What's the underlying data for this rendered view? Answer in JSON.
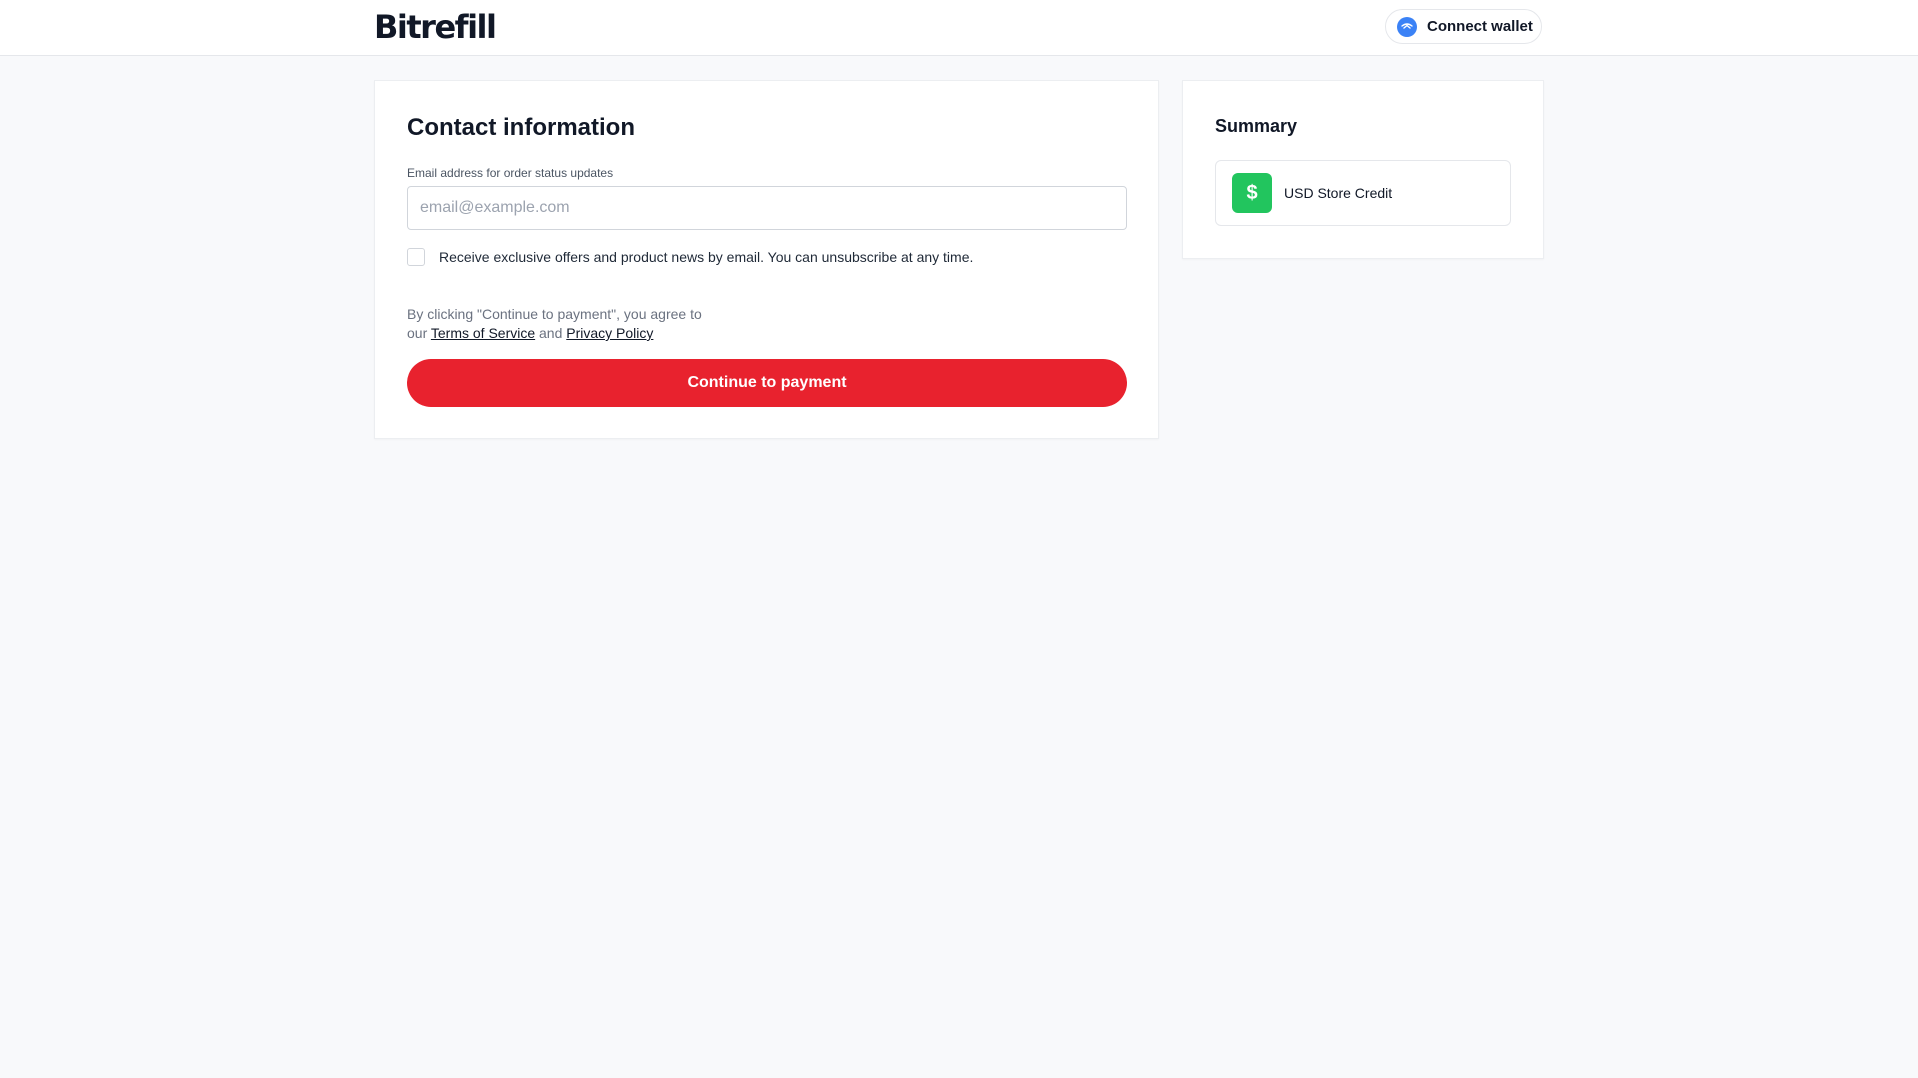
{
  "header": {
    "logo_text": "Bitrefill",
    "connect_wallet_label": "Connect wallet",
    "wallet_icon": "wallet-connect-icon"
  },
  "contact": {
    "title": "Contact information",
    "email_label": "Email address for order status updates",
    "email_value": "",
    "email_placeholder": "email@example.com",
    "newsletter_label": "Receive exclusive offers and product news by email. You can unsubscribe at any time.",
    "newsletter_checked": false,
    "terms_prefix": "By clicking \"Continue to payment\", you agree to",
    "terms_our": "our",
    "terms_link": "Terms of Service",
    "terms_and": "and",
    "privacy_link": "Privacy Policy",
    "continue_label": "Continue to payment"
  },
  "summary": {
    "title": "Summary",
    "item_label": "USD Store Credit",
    "item_icon": "dollar-icon",
    "item_icon_glyph": "$"
  },
  "colors": {
    "accent_red": "#e8222e",
    "credit_green": "#22c55e",
    "wallet_blue": "#3b82f6",
    "page_bg": "#f8f9fb"
  }
}
